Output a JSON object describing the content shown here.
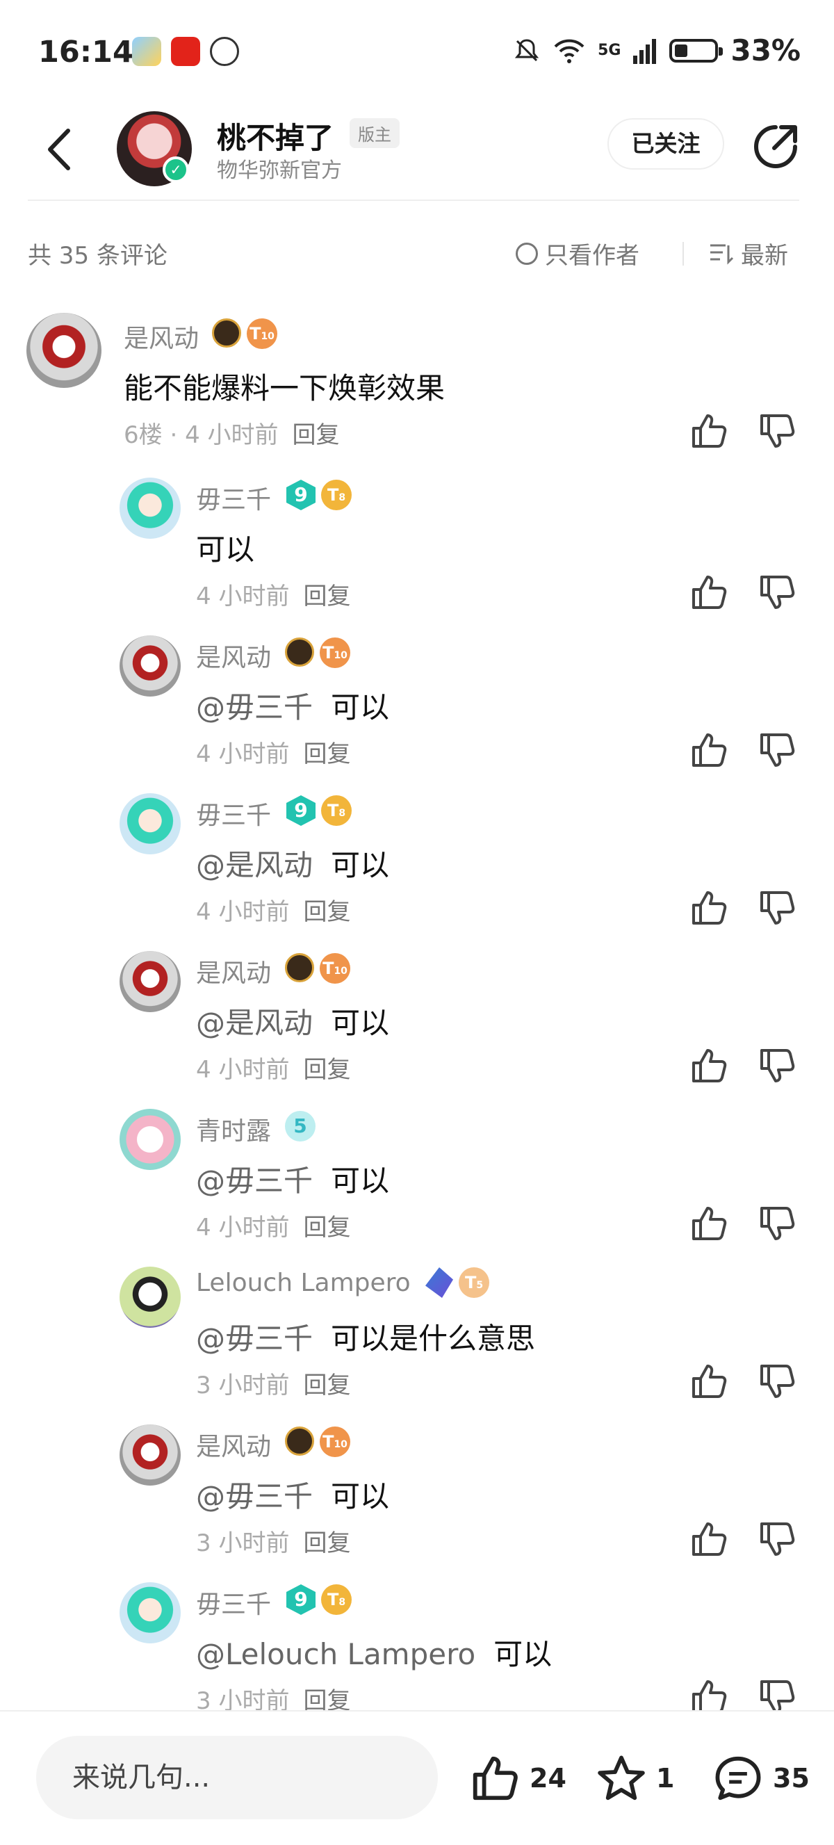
{
  "status_bar": {
    "time": "16:14",
    "network": "5G",
    "battery": "33%",
    "battery_level": 0.33
  },
  "header": {
    "title": "桃不掉了",
    "mod_badge": "版主",
    "subtitle": "物华弥新官方",
    "follow_label": "已关注"
  },
  "filter": {
    "count_text": "共 35 条评论",
    "only_author": "只看作者",
    "sort": "最新"
  },
  "comments": [
    {
      "user": "是风动",
      "text": "能不能爆料一下焕彰效果",
      "floor": "6楼 · ",
      "time": "4 小时前",
      "reply": "回复",
      "level": "10"
    },
    {
      "user": "毋三千",
      "mention": "",
      "text": "可以",
      "time": "4 小时前",
      "reply": "回复",
      "level": "8",
      "badge_text": "9"
    },
    {
      "user": "是风动",
      "mention": "@毋三千",
      "text": "可以",
      "time": "4 小时前",
      "reply": "回复",
      "level": "10"
    },
    {
      "user": "毋三千",
      "mention": "@是风动",
      "text": "可以",
      "time": "4 小时前",
      "reply": "回复",
      "level": "8",
      "badge_text": "9"
    },
    {
      "user": "是风动",
      "mention": "@是风动",
      "text": "可以",
      "time": "4 小时前",
      "reply": "回复",
      "level": "10"
    },
    {
      "user": "青时露",
      "mention": "@毋三千",
      "text": "可以",
      "time": "4 小时前",
      "reply": "回复",
      "badge_text": "5"
    },
    {
      "user": "Lelouch Lampero",
      "mention": "@毋三千",
      "text": "可以是什么意思",
      "time": "3 小时前",
      "reply": "回复",
      "level": "5"
    },
    {
      "user": "是风动",
      "mention": "@毋三千",
      "text": "可以",
      "time": "3 小时前",
      "reply": "回复",
      "level": "10"
    },
    {
      "user": "毋三千",
      "mention": "@Lelouch Lampero",
      "text": "可以",
      "time": "3 小时前",
      "reply": "回复",
      "level": "8",
      "badge_text": "9"
    }
  ],
  "bottom_bar": {
    "input_placeholder": "来说几句...",
    "likes": "24",
    "stars": "1",
    "comments": "35"
  },
  "colors": {
    "verified": "#1cc38a",
    "level_orange": "#f0944a",
    "level_gold": "#f2b53a",
    "teal_badge": "#22c3b0"
  }
}
